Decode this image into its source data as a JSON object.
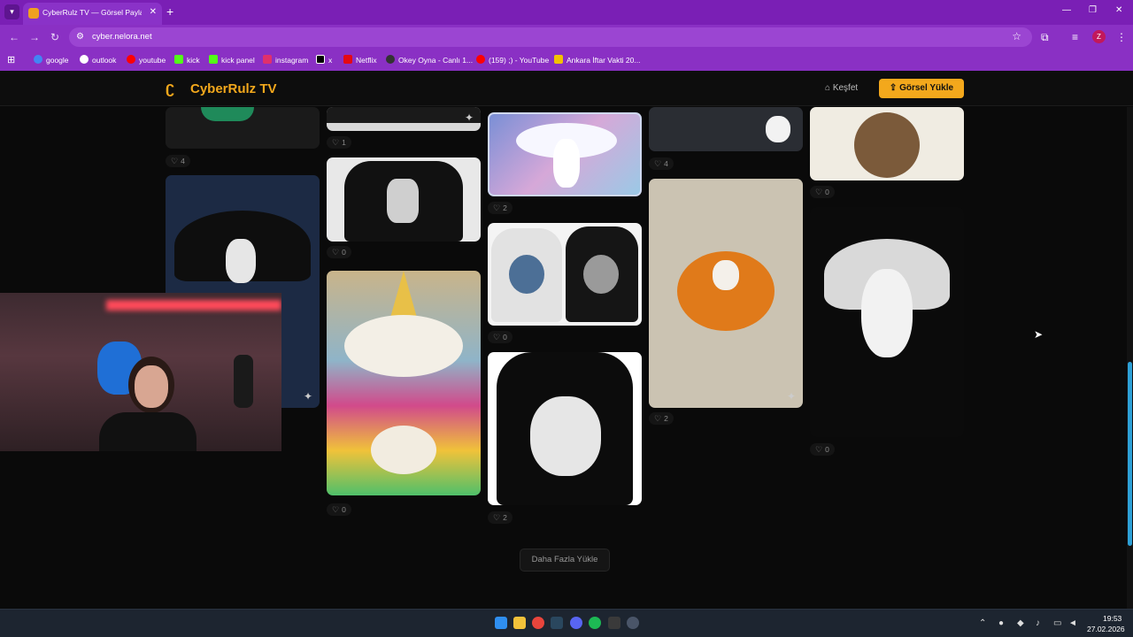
{
  "browser": {
    "tab_title": "CyberRulz TV — Görsel Paylaşım",
    "url": "cyber.nelora.net",
    "profile_initial": "Z",
    "bookmarks": [
      {
        "label": "google",
        "color": "#4285f4"
      },
      {
        "label": "outlook",
        "color": "#ffffff"
      },
      {
        "label": "youtube",
        "color": "#ff0000"
      },
      {
        "label": "kick",
        "color": "#53fc18"
      },
      {
        "label": "kick panel",
        "color": "#53fc18"
      },
      {
        "label": "instagram",
        "color": "#e1306c"
      },
      {
        "label": "x",
        "color": "#000000"
      },
      {
        "label": "Netflix",
        "color": "#e50914"
      },
      {
        "label": "Okey Oyna - Canlı 1...",
        "color": "#333333"
      },
      {
        "label": "(159) ;) - YouTube",
        "color": "#ff0000"
      },
      {
        "label": "Ankara İftar Vakti 20...",
        "color": "#f2c200"
      }
    ]
  },
  "site": {
    "logo_text": "CyberRulz TV",
    "nav_explore": "Keşfet",
    "upload_button": "Görsel Yükle",
    "load_more": "Daha Fazla Yükle"
  },
  "gallery": {
    "likes": {
      "c1a": "4",
      "c2a": "1",
      "c2b": "0",
      "c2c": "0",
      "c3a": "2",
      "c3b": "0",
      "c3c": "2",
      "c4a": "4",
      "c4b": "2",
      "c5a": "0",
      "c5b": "0"
    }
  },
  "taskbar": {
    "time": "19:53",
    "date": "27.02.2026"
  }
}
